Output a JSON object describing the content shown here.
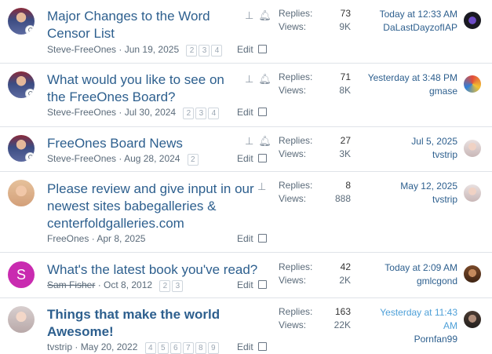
{
  "threads": [
    {
      "title": "Major Changes to the Word Censor List",
      "author": "Steve-FreeOnes",
      "date": "Jun 19, 2025",
      "pages": [
        "2",
        "3",
        "4"
      ],
      "replies_label": "Replies:",
      "replies": "73",
      "views_label": "Views:",
      "views": "9K",
      "last_date": "Today at 12:33 AM",
      "last_user": "DaLastDayzofIAP",
      "edit_label": "Edit",
      "icons": [
        "pin-icon",
        "bell-icon"
      ]
    },
    {
      "title": "What would you like to see on the FreeOnes Board?",
      "author": "Steve-FreeOnes",
      "date": "Jul 30, 2024",
      "pages": [
        "2",
        "3",
        "4"
      ],
      "replies_label": "Replies:",
      "replies": "71",
      "views_label": "Views:",
      "views": "8K",
      "last_date": "Yesterday at 3:48 PM",
      "last_user": "gmase",
      "edit_label": "Edit",
      "icons": [
        "pin-icon",
        "bell-icon"
      ]
    },
    {
      "title": "FreeOnes Board News",
      "author": "Steve-FreeOnes",
      "date": "Aug 28, 2024",
      "pages": [
        "2"
      ],
      "replies_label": "Replies:",
      "replies": "27",
      "views_label": "Views:",
      "views": "3K",
      "last_date": "Jul 5, 2025",
      "last_user": "tvstrip",
      "edit_label": "Edit",
      "icons": [
        "pin-icon",
        "bell-icon"
      ]
    },
    {
      "title": "Please review and give input in our newest sites babegalleries & centerfoldgalleries.com",
      "author": "FreeOnes",
      "date": "Apr 8, 2025",
      "pages": [],
      "replies_label": "Replies:",
      "replies": "8",
      "views_label": "Views:",
      "views": "888",
      "last_date": "May 12, 2025",
      "last_user": "tvstrip",
      "edit_label": "Edit",
      "icons": [
        "pin-icon"
      ]
    },
    {
      "title": "What's the latest book you've read?",
      "author": "Sam Fisher",
      "date": "Oct 8, 2012",
      "pages": [
        "2",
        "3"
      ],
      "replies_label": "Replies:",
      "replies": "42",
      "views_label": "Views:",
      "views": "2K",
      "last_date": "Today at 2:09 AM",
      "last_user": "gmlcgond",
      "edit_label": "Edit",
      "avatar_letter": "S",
      "icons": []
    },
    {
      "title": "Things that make the world Awesome!",
      "author": "tvstrip",
      "date": "May 20, 2022",
      "pages": [
        "4",
        "5",
        "6",
        "7",
        "8",
        "9"
      ],
      "replies_label": "Replies:",
      "replies": "163",
      "views_label": "Views:",
      "views": "22K",
      "last_date": "Yesterday at 11:43 AM",
      "last_user": "Pornfan99",
      "edit_label": "Edit",
      "icons": []
    }
  ],
  "colors": {
    "link": "#2d5f8e",
    "muted": "#5b6b7a",
    "light_link": "#4ea0d8",
    "divider": "#dfe3e8"
  }
}
